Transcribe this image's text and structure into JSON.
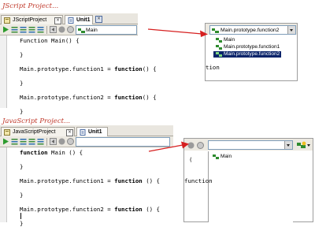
{
  "captions": {
    "top": "JScript Project...",
    "bottom": "JavaScript Project..."
  },
  "top_editor": {
    "tabs": [
      {
        "label": "JScriptProject",
        "active": false
      },
      {
        "label": "Unit1",
        "active": true
      }
    ],
    "toolbar": {
      "selector_value": "Main"
    },
    "code_lines": [
      [
        "Function Main() {",
        ""
      ],
      [
        "",
        ""
      ],
      [
        "}",
        ""
      ],
      [
        "",
        ""
      ],
      [
        "Main.prototype.function1 = ",
        "function",
        "() {"
      ],
      [
        "",
        ""
      ],
      [
        "}",
        ""
      ],
      [
        "",
        ""
      ],
      [
        "Main.prototype.function2 = ",
        "function",
        "() {"
      ],
      [
        "",
        ""
      ],
      [
        "}",
        ""
      ]
    ]
  },
  "top_popup": {
    "selected_value": "Main.prototype.function2",
    "items": [
      {
        "label": "Main",
        "selected": false
      },
      {
        "label": "Main.prototype.function1",
        "selected": false
      },
      {
        "label": "Main.prototype.function2",
        "selected": true
      }
    ],
    "background_fragment": "tion"
  },
  "bottom_editor": {
    "tabs": [
      {
        "label": "JavaScriptProject",
        "active": false
      },
      {
        "label": "Unit1",
        "active": true
      }
    ],
    "code_lines": [
      [
        "function",
        " Main () {"
      ],
      [
        "",
        ""
      ],
      [
        "}",
        ""
      ],
      [
        "",
        ""
      ],
      [
        "Main.prototype.function1 = ",
        "function",
        " () {"
      ],
      [
        "",
        ""
      ],
      [
        "}",
        ""
      ],
      [
        "",
        ""
      ],
      [
        "Main.prototype.function2 = ",
        "function",
        " () {"
      ],
      [
        "",
        ""
      ],
      [
        "}",
        ""
      ]
    ]
  },
  "bottom_popup": {
    "selected_value": "",
    "items": [
      {
        "label": "Main",
        "selected": false
      }
    ],
    "background_fragments": [
      "(",
      "",
      "function",
      "",
      ""
    ]
  },
  "colors": {
    "caption": "#c0392b",
    "arrow": "#d62020",
    "selection": "#0a246a",
    "method_icon": "#2e8b2e"
  }
}
